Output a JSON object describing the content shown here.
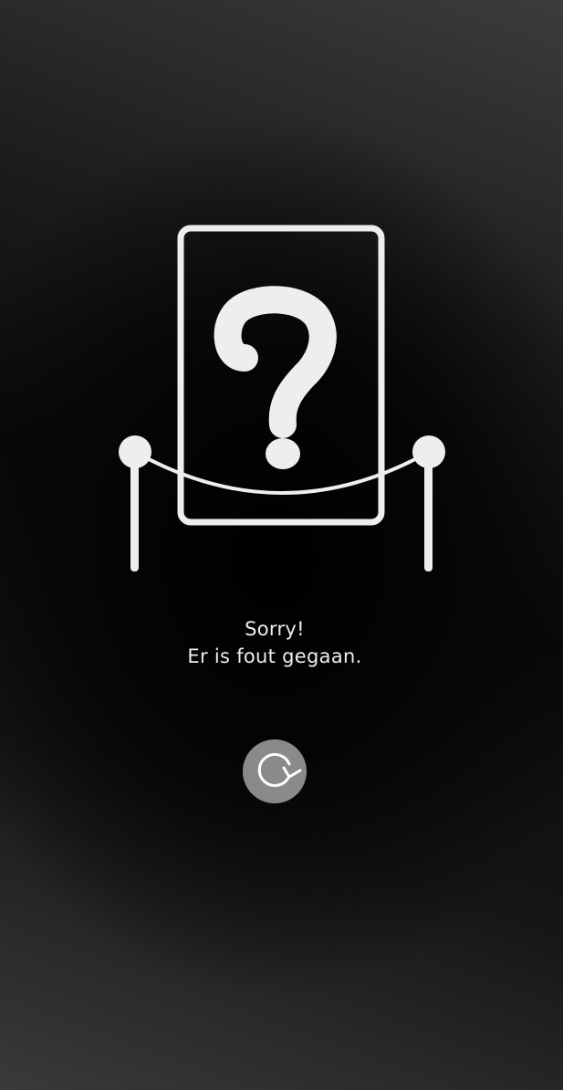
{
  "error": {
    "title": "Sorry!",
    "message": "Er is fout gegaan."
  },
  "retry_button": {
    "icon": "refresh-icon"
  },
  "illustration": {
    "icon": "question-mark-icon",
    "color": "#eeeeee"
  },
  "colors": {
    "foreground": "#eeeeee",
    "button_background": "#8a8a8a"
  }
}
